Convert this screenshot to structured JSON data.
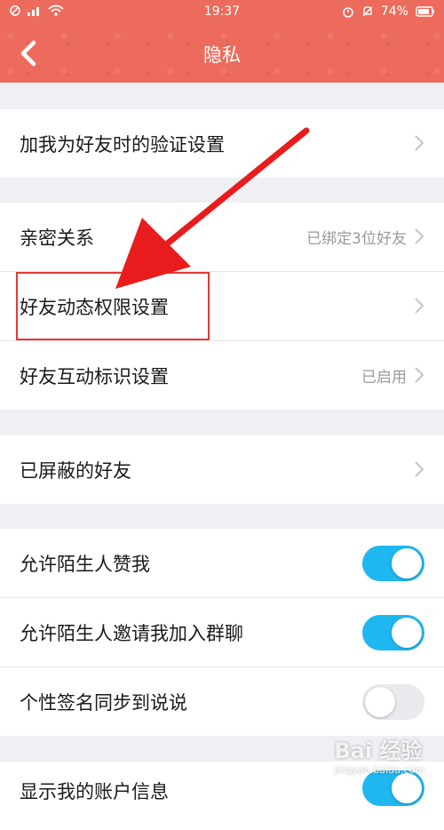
{
  "status_bar": {
    "time": "19:37",
    "battery": "74%"
  },
  "nav": {
    "title": "隐私"
  },
  "groups": [
    {
      "rows": [
        {
          "label": "加我为好友时的验证设置",
          "value": ""
        }
      ]
    },
    {
      "rows": [
        {
          "label": "亲密关系",
          "value": "已绑定3位好友"
        },
        {
          "label": "好友动态权限设置",
          "value": ""
        },
        {
          "label": "好友互动标识设置",
          "value": "已启用"
        }
      ]
    },
    {
      "rows": [
        {
          "label": "已屏蔽的好友",
          "value": ""
        }
      ]
    },
    {
      "rows": [
        {
          "label": "允许陌生人赞我",
          "toggle": true
        },
        {
          "label": "允许陌生人邀请我加入群聊",
          "toggle": true
        },
        {
          "label": "个性签名同步到说说",
          "toggle": false
        }
      ]
    },
    {
      "rows": [
        {
          "label": "显示我的账户信息",
          "toggle": true
        }
      ]
    }
  ],
  "colors": {
    "header": "#ec6b5c",
    "toggle_on": "#1fb7f0",
    "toggle_off": "#e9e9ee",
    "highlight": "#e53935"
  },
  "icons": {
    "back": "chevron-left-icon",
    "row_chevron": "chevron-right-icon"
  },
  "watermark": {
    "text": "Bai 经验",
    "sub": "jingyan.baidu.com"
  }
}
